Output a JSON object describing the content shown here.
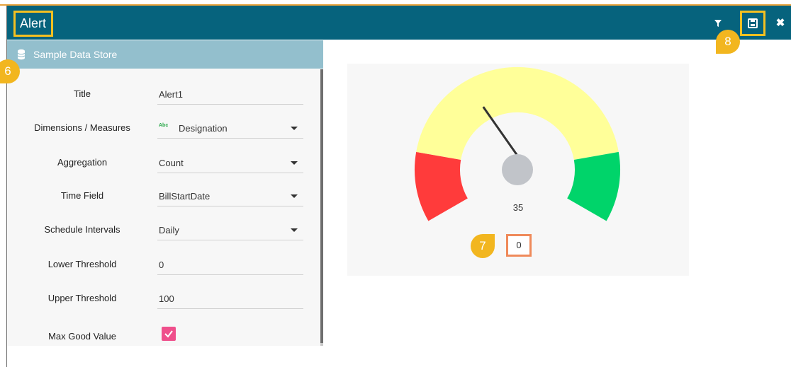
{
  "window": {
    "title": "Alert"
  },
  "header": {
    "filter_icon": "filter-icon",
    "save_icon": "save-icon",
    "close_icon": "close-icon",
    "close_glyph": "✖"
  },
  "markers": {
    "m6": "6",
    "m7": "7",
    "m8": "8"
  },
  "panel": {
    "datastore_label": "Sample Data Store",
    "datastore_icon": "database-icon",
    "fields": [
      {
        "label": "Title",
        "value": "Alert1"
      },
      {
        "label": "Dimensions / Measures",
        "value": "Designation",
        "type_badge": "Abc"
      },
      {
        "label": "Aggregation",
        "value": "Count"
      },
      {
        "label": "Time Field",
        "value": "BillStartDate"
      },
      {
        "label": "Schedule Intervals",
        "value": "Daily"
      },
      {
        "label": "Lower Threshold",
        "value": "0"
      },
      {
        "label": "Upper Threshold",
        "value": "100"
      },
      {
        "label": "Max Good Value",
        "checked": true
      }
    ]
  },
  "gauge": {
    "value": "35",
    "min_label": "0",
    "colors": {
      "low": "#ff3b3b",
      "mid": "#ffff99",
      "high": "#00d46a",
      "hub": "#c1c4c9",
      "needle": "#333333"
    }
  }
}
